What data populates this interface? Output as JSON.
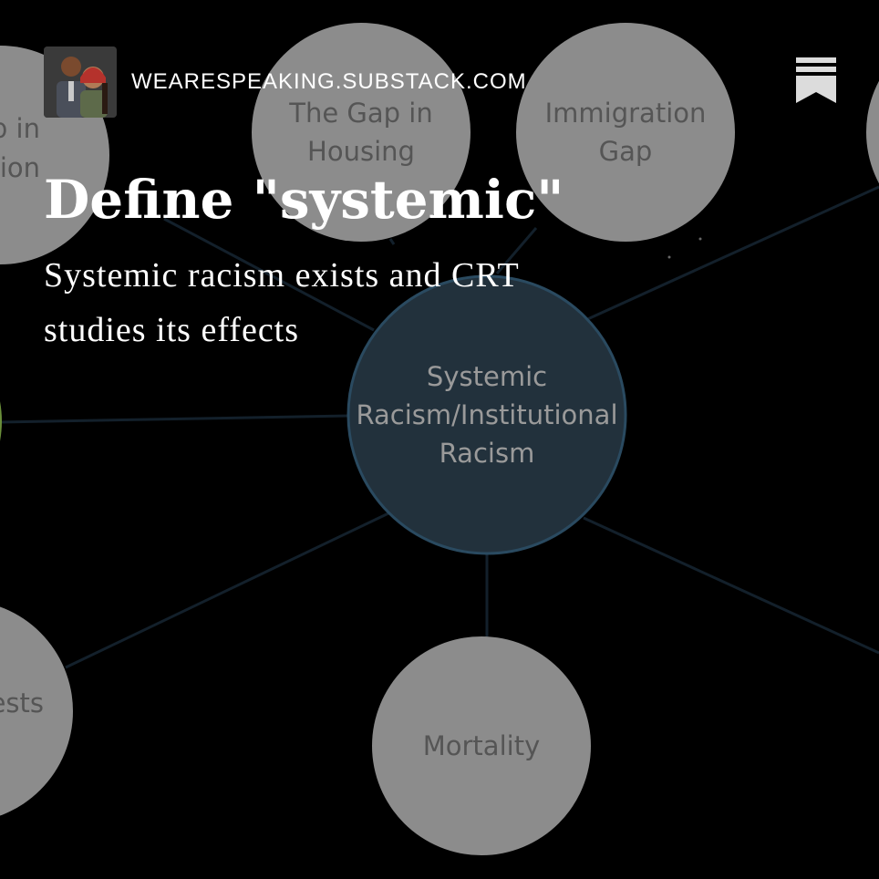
{
  "header": {
    "site_name": "WEARESPEAKING.SUBSTACK.COM",
    "avatar_icon": "authors-avatar",
    "bookmark_icon": "substack-bookmark-icon"
  },
  "post": {
    "title": "Define \"systemic\"",
    "subtitle": "Systemic racism exists and CRT studies its effects"
  },
  "diagram": {
    "background": "#000000",
    "node_fill": "#8c8c8c",
    "node_text": "#555555",
    "center_fill": "#22313c",
    "center_stroke": "#2a4a60",
    "center_text": "#9a9a9a",
    "edge_color": "#13202b",
    "center": {
      "lines": [
        "Systemic",
        "Racism/Institutional",
        "Racism"
      ]
    },
    "nodes": [
      {
        "id": "left-top",
        "lines": [
          "p in",
          "ation"
        ]
      },
      {
        "id": "housing",
        "lines": [
          "The Gap in",
          "Housing"
        ]
      },
      {
        "id": "immigration",
        "lines": [
          "Immigration",
          "Gap"
        ]
      },
      {
        "id": "right-top",
        "lines": []
      },
      {
        "id": "left-bottom",
        "lines": [
          "ests"
        ]
      },
      {
        "id": "mortality",
        "lines": [
          "Mortality"
        ]
      },
      {
        "id": "right-bottom",
        "lines": []
      },
      {
        "id": "left-mid",
        "lines": []
      }
    ]
  }
}
